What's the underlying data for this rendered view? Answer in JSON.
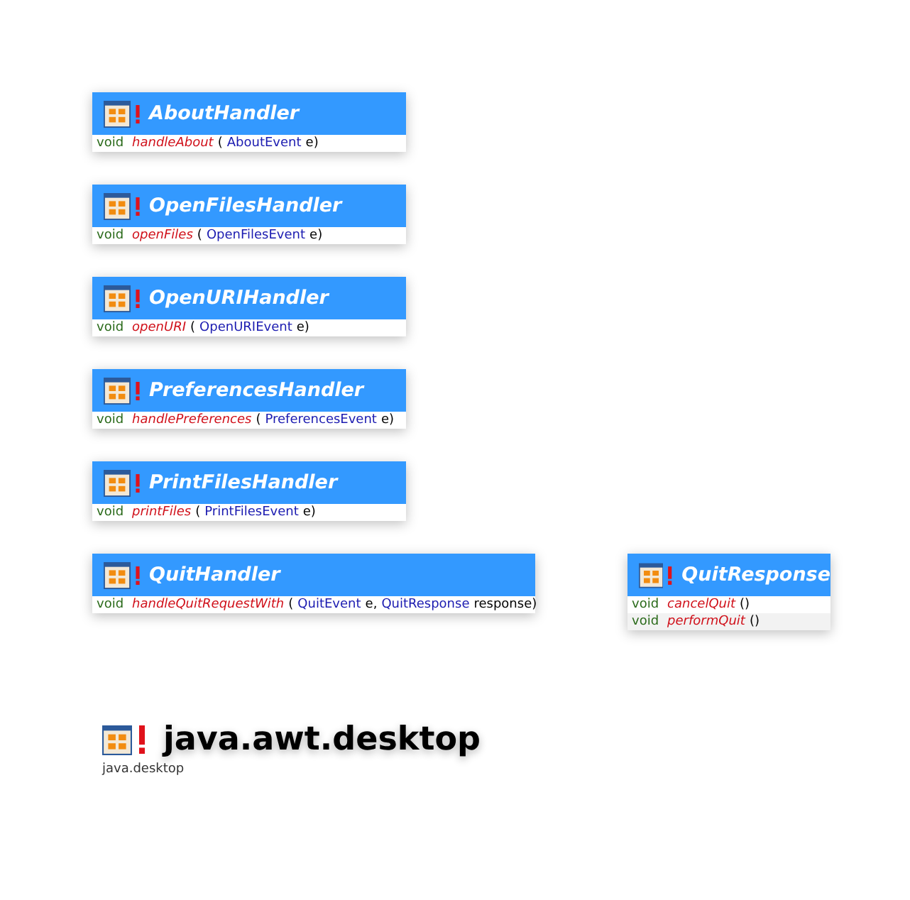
{
  "classes": [
    {
      "title": "AboutHandler",
      "methods": [
        {
          "tokens": [
            {
              "kind": "return",
              "text": "void"
            },
            {
              "kind": "method",
              "text": "handleAbout"
            },
            {
              "kind": "punct",
              "text": "("
            },
            {
              "kind": "type",
              "text": "AboutEvent"
            },
            {
              "kind": "param",
              "text": "e"
            },
            {
              "kind": "punct",
              "text": ")"
            }
          ]
        }
      ]
    },
    {
      "title": "OpenFilesHandler",
      "methods": [
        {
          "tokens": [
            {
              "kind": "return",
              "text": "void"
            },
            {
              "kind": "method",
              "text": "openFiles"
            },
            {
              "kind": "punct",
              "text": "("
            },
            {
              "kind": "type",
              "text": "OpenFilesEvent"
            },
            {
              "kind": "param",
              "text": "e"
            },
            {
              "kind": "punct",
              "text": ")"
            }
          ]
        }
      ]
    },
    {
      "title": "OpenURIHandler",
      "methods": [
        {
          "tokens": [
            {
              "kind": "return",
              "text": "void"
            },
            {
              "kind": "method",
              "text": "openURI"
            },
            {
              "kind": "punct",
              "text": "("
            },
            {
              "kind": "type",
              "text": "OpenURIEvent"
            },
            {
              "kind": "param",
              "text": "e"
            },
            {
              "kind": "punct",
              "text": ")"
            }
          ]
        }
      ]
    },
    {
      "title": "PreferencesHandler",
      "methods": [
        {
          "tokens": [
            {
              "kind": "return",
              "text": "void"
            },
            {
              "kind": "method",
              "text": "handlePreferences"
            },
            {
              "kind": "punct",
              "text": "("
            },
            {
              "kind": "type",
              "text": "PreferencesEvent"
            },
            {
              "kind": "param",
              "text": "e"
            },
            {
              "kind": "punct",
              "text": ")"
            }
          ]
        }
      ]
    },
    {
      "title": "PrintFilesHandler",
      "methods": [
        {
          "tokens": [
            {
              "kind": "return",
              "text": "void"
            },
            {
              "kind": "method",
              "text": "printFiles"
            },
            {
              "kind": "punct",
              "text": "("
            },
            {
              "kind": "type",
              "text": "PrintFilesEvent"
            },
            {
              "kind": "param",
              "text": "e"
            },
            {
              "kind": "punct",
              "text": ")"
            }
          ]
        }
      ]
    },
    {
      "title": "QuitHandler",
      "methods": [
        {
          "tokens": [
            {
              "kind": "return",
              "text": "void"
            },
            {
              "kind": "method",
              "text": "handleQuitRequestWith"
            },
            {
              "kind": "punct",
              "text": "("
            },
            {
              "kind": "type",
              "text": "QuitEvent"
            },
            {
              "kind": "param",
              "text": "e"
            },
            {
              "kind": "punct",
              "text": ","
            },
            {
              "kind": "type",
              "text": "QuitResponse"
            },
            {
              "kind": "param",
              "text": "response"
            },
            {
              "kind": "punct",
              "text": ")"
            }
          ]
        }
      ]
    },
    {
      "title": "QuitResponse",
      "methods": [
        {
          "tokens": [
            {
              "kind": "return",
              "text": "void"
            },
            {
              "kind": "method",
              "text": "cancelQuit"
            },
            {
              "kind": "punct",
              "text": "()"
            }
          ]
        },
        {
          "tokens": [
            {
              "kind": "return",
              "text": "void"
            },
            {
              "kind": "method",
              "text": "performQuit"
            },
            {
              "kind": "punct",
              "text": "()"
            }
          ]
        }
      ]
    }
  ],
  "package": {
    "title": "java.awt.desktop",
    "module": "java.desktop"
  }
}
